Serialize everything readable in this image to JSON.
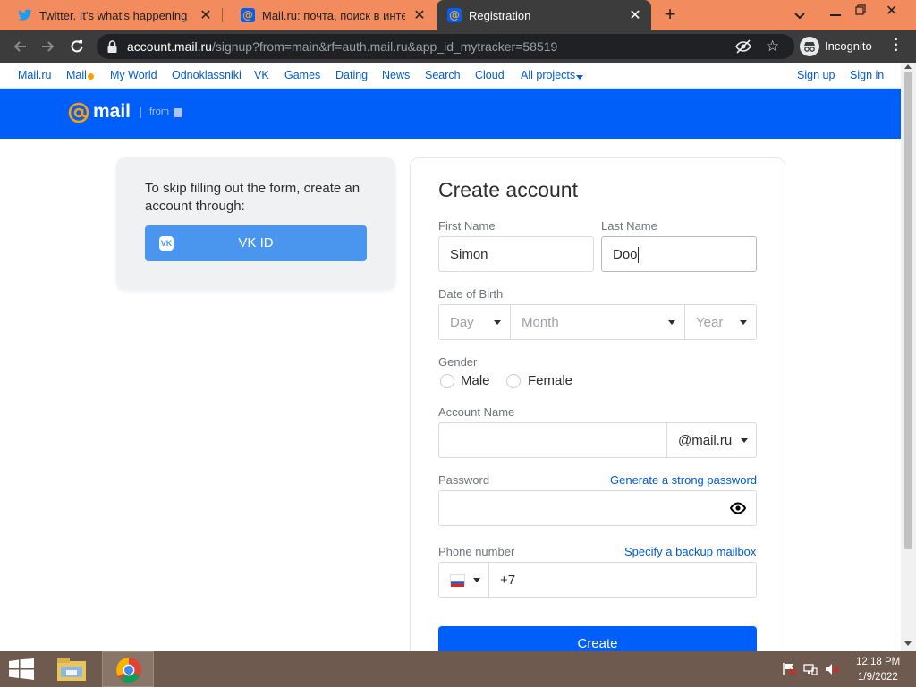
{
  "browser": {
    "tabs": [
      {
        "title": "Twitter. It's what's happening / Tw",
        "icon": "twitter-icon",
        "active": false
      },
      {
        "title": "Mail.ru: почта, поиск в интернет",
        "icon": "mailru-at-icon",
        "active": false
      },
      {
        "title": "Registration",
        "icon": "mailru-at-icon",
        "active": true
      }
    ],
    "url_host": "account.mail.ru",
    "url_path": "/signup?from=main&rf=auth.mail.ru&app_id_mytracker=58519",
    "incognito_label": "Incognito",
    "colors": {
      "tabstrip": "#f28c5f",
      "toolbar": "#3c3c3c",
      "omnibox": "#202124"
    }
  },
  "portal_nav": {
    "links": [
      "Mail.ru",
      "Mail",
      "My World",
      "Odnoklassniki",
      "VK",
      "Games",
      "Dating",
      "News",
      "Search",
      "Cloud",
      "All projects"
    ],
    "signup": "Sign up",
    "signin": "Sign in"
  },
  "header": {
    "logo_text": "mail",
    "from_label": "from",
    "color": "#005ff9"
  },
  "vk_card": {
    "text": "To skip filling out the form, create an account through:",
    "button_label": "VK ID",
    "button_color": "#4a95ee"
  },
  "form": {
    "title": "Create account",
    "first_name": {
      "label": "First Name",
      "value": "Simon"
    },
    "last_name": {
      "label": "Last Name",
      "value": "Doo"
    },
    "dob": {
      "label": "Date of Birth",
      "day": "Day",
      "month": "Month",
      "year": "Year"
    },
    "gender": {
      "label": "Gender",
      "options": [
        "Male",
        "Female"
      ]
    },
    "account": {
      "label": "Account Name",
      "value": "",
      "domain": "@mail.ru"
    },
    "password": {
      "label": "Password",
      "value": "",
      "generate_link": "Generate a strong password"
    },
    "phone": {
      "label": "Phone number",
      "backup_link": "Specify a backup mailbox",
      "prefix": "+7"
    },
    "submit": "Create"
  },
  "taskbar": {
    "time": "12:18 PM",
    "date": "1/9/2022"
  }
}
